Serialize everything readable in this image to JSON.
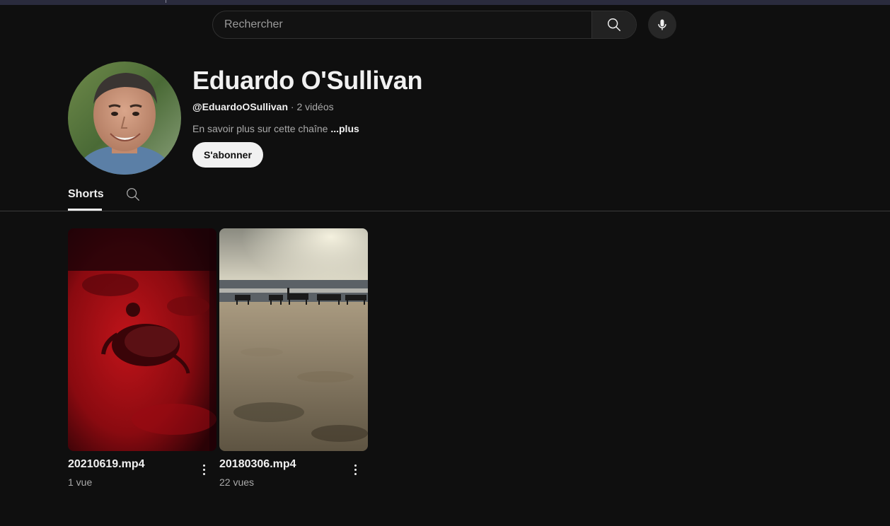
{
  "search": {
    "placeholder": "Rechercher",
    "icon": "search-icon"
  },
  "mic": {
    "icon": "microphone-icon"
  },
  "channel": {
    "name": "Eduardo O'Sullivan",
    "handle": "@EduardoOSullivan",
    "separator": " · ",
    "video_count": "2 vidéos",
    "description": "En savoir plus sur cette chaîne ",
    "more_label": "...plus",
    "subscribe_label": "S'abonner"
  },
  "tabs": [
    {
      "label": "Shorts",
      "active": true
    }
  ],
  "shorts": [
    {
      "title": "20210619.mp4",
      "views": "1 vue"
    },
    {
      "title": "20180306.mp4",
      "views": "22 vues"
    }
  ],
  "colors": {
    "background": "#0f0f0f",
    "text": "#f1f1f1",
    "secondary_text": "#aaaaaa"
  }
}
